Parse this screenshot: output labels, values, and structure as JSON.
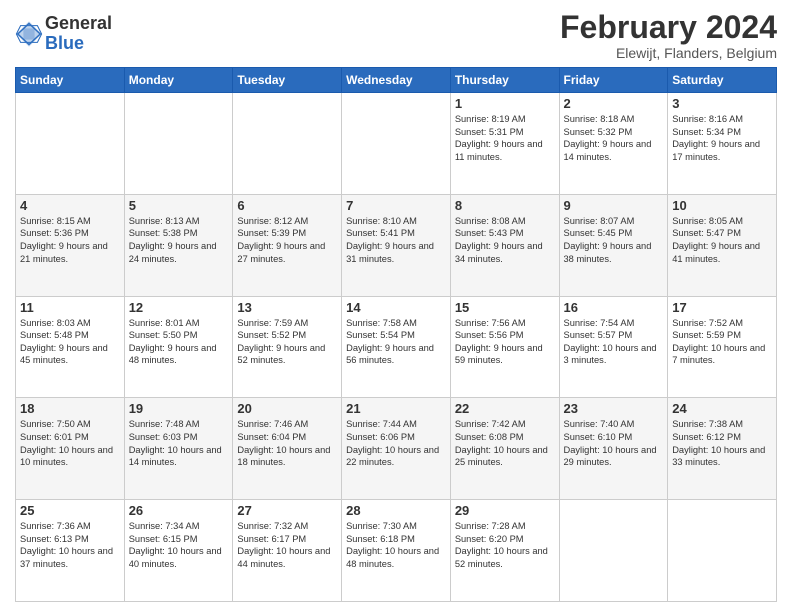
{
  "header": {
    "logo_general": "General",
    "logo_blue": "Blue",
    "title": "February 2024",
    "subtitle": "Elewijt, Flanders, Belgium"
  },
  "days_of_week": [
    "Sunday",
    "Monday",
    "Tuesday",
    "Wednesday",
    "Thursday",
    "Friday",
    "Saturday"
  ],
  "weeks": [
    [
      {
        "day": "",
        "info": ""
      },
      {
        "day": "",
        "info": ""
      },
      {
        "day": "",
        "info": ""
      },
      {
        "day": "",
        "info": ""
      },
      {
        "day": "1",
        "info": "Sunrise: 8:19 AM\nSunset: 5:31 PM\nDaylight: 9 hours and 11 minutes."
      },
      {
        "day": "2",
        "info": "Sunrise: 8:18 AM\nSunset: 5:32 PM\nDaylight: 9 hours and 14 minutes."
      },
      {
        "day": "3",
        "info": "Sunrise: 8:16 AM\nSunset: 5:34 PM\nDaylight: 9 hours and 17 minutes."
      }
    ],
    [
      {
        "day": "4",
        "info": "Sunrise: 8:15 AM\nSunset: 5:36 PM\nDaylight: 9 hours and 21 minutes."
      },
      {
        "day": "5",
        "info": "Sunrise: 8:13 AM\nSunset: 5:38 PM\nDaylight: 9 hours and 24 minutes."
      },
      {
        "day": "6",
        "info": "Sunrise: 8:12 AM\nSunset: 5:39 PM\nDaylight: 9 hours and 27 minutes."
      },
      {
        "day": "7",
        "info": "Sunrise: 8:10 AM\nSunset: 5:41 PM\nDaylight: 9 hours and 31 minutes."
      },
      {
        "day": "8",
        "info": "Sunrise: 8:08 AM\nSunset: 5:43 PM\nDaylight: 9 hours and 34 minutes."
      },
      {
        "day": "9",
        "info": "Sunrise: 8:07 AM\nSunset: 5:45 PM\nDaylight: 9 hours and 38 minutes."
      },
      {
        "day": "10",
        "info": "Sunrise: 8:05 AM\nSunset: 5:47 PM\nDaylight: 9 hours and 41 minutes."
      }
    ],
    [
      {
        "day": "11",
        "info": "Sunrise: 8:03 AM\nSunset: 5:48 PM\nDaylight: 9 hours and 45 minutes."
      },
      {
        "day": "12",
        "info": "Sunrise: 8:01 AM\nSunset: 5:50 PM\nDaylight: 9 hours and 48 minutes."
      },
      {
        "day": "13",
        "info": "Sunrise: 7:59 AM\nSunset: 5:52 PM\nDaylight: 9 hours and 52 minutes."
      },
      {
        "day": "14",
        "info": "Sunrise: 7:58 AM\nSunset: 5:54 PM\nDaylight: 9 hours and 56 minutes."
      },
      {
        "day": "15",
        "info": "Sunrise: 7:56 AM\nSunset: 5:56 PM\nDaylight: 9 hours and 59 minutes."
      },
      {
        "day": "16",
        "info": "Sunrise: 7:54 AM\nSunset: 5:57 PM\nDaylight: 10 hours and 3 minutes."
      },
      {
        "day": "17",
        "info": "Sunrise: 7:52 AM\nSunset: 5:59 PM\nDaylight: 10 hours and 7 minutes."
      }
    ],
    [
      {
        "day": "18",
        "info": "Sunrise: 7:50 AM\nSunset: 6:01 PM\nDaylight: 10 hours and 10 minutes."
      },
      {
        "day": "19",
        "info": "Sunrise: 7:48 AM\nSunset: 6:03 PM\nDaylight: 10 hours and 14 minutes."
      },
      {
        "day": "20",
        "info": "Sunrise: 7:46 AM\nSunset: 6:04 PM\nDaylight: 10 hours and 18 minutes."
      },
      {
        "day": "21",
        "info": "Sunrise: 7:44 AM\nSunset: 6:06 PM\nDaylight: 10 hours and 22 minutes."
      },
      {
        "day": "22",
        "info": "Sunrise: 7:42 AM\nSunset: 6:08 PM\nDaylight: 10 hours and 25 minutes."
      },
      {
        "day": "23",
        "info": "Sunrise: 7:40 AM\nSunset: 6:10 PM\nDaylight: 10 hours and 29 minutes."
      },
      {
        "day": "24",
        "info": "Sunrise: 7:38 AM\nSunset: 6:12 PM\nDaylight: 10 hours and 33 minutes."
      }
    ],
    [
      {
        "day": "25",
        "info": "Sunrise: 7:36 AM\nSunset: 6:13 PM\nDaylight: 10 hours and 37 minutes."
      },
      {
        "day": "26",
        "info": "Sunrise: 7:34 AM\nSunset: 6:15 PM\nDaylight: 10 hours and 40 minutes."
      },
      {
        "day": "27",
        "info": "Sunrise: 7:32 AM\nSunset: 6:17 PM\nDaylight: 10 hours and 44 minutes."
      },
      {
        "day": "28",
        "info": "Sunrise: 7:30 AM\nSunset: 6:18 PM\nDaylight: 10 hours and 48 minutes."
      },
      {
        "day": "29",
        "info": "Sunrise: 7:28 AM\nSunset: 6:20 PM\nDaylight: 10 hours and 52 minutes."
      },
      {
        "day": "",
        "info": ""
      },
      {
        "day": "",
        "info": ""
      }
    ]
  ]
}
